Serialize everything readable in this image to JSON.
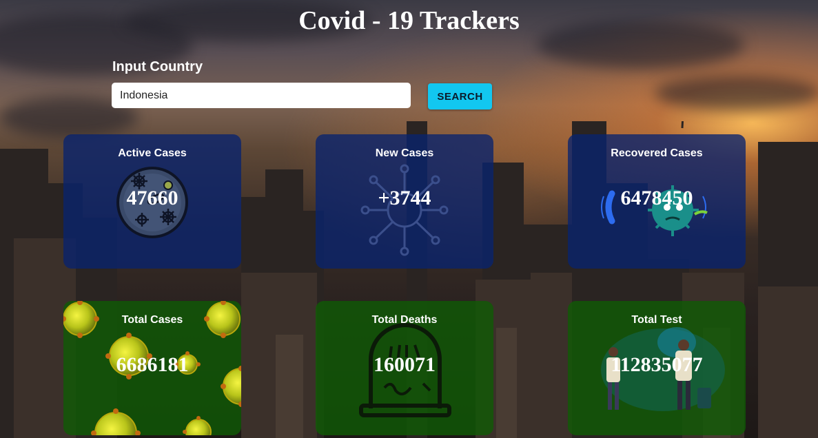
{
  "header": {
    "title": "Covid - 19 Trackers"
  },
  "search": {
    "label": "Input Country",
    "value": "Indonesia",
    "button_label": "SEARCH"
  },
  "cards": [
    {
      "title": "Active Cases",
      "value": "47660",
      "icon": "bacteria-icon",
      "color": "#08226e"
    },
    {
      "title": "New Cases",
      "value": "+3744",
      "icon": "virus-network-icon",
      "color": "#08226e"
    },
    {
      "title": "Recovered Cases",
      "value": "6478450",
      "icon": "virus-character-icon",
      "color": "#08226e"
    },
    {
      "title": "Total Cases",
      "value": "6686181",
      "icon": "virus-particles-icon",
      "color": "#0e5c04"
    },
    {
      "title": "Total Deaths",
      "value": "160071",
      "icon": "tombstone-icon",
      "color": "#0e5c04"
    },
    {
      "title": "Total Test",
      "value": "112835077",
      "icon": "doctors-icon",
      "color": "#0e5c04"
    }
  ],
  "colors": {
    "accent": "#12c7f0",
    "card_blue": "#08226e",
    "card_green": "#0e5c04"
  }
}
